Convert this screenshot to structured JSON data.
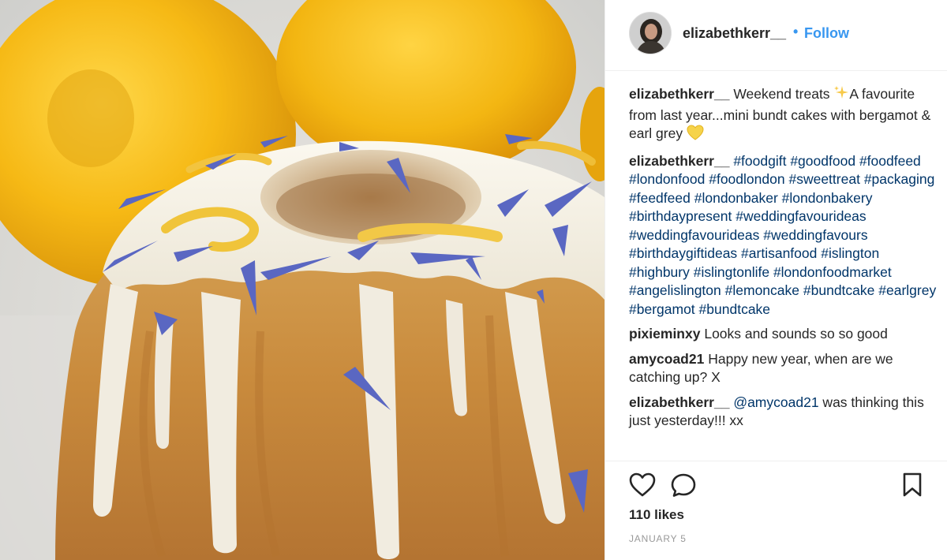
{
  "post": {
    "username": "elizabethkerr__",
    "follow_dot": "•",
    "follow_label": "Follow",
    "likes": "110 likes",
    "date": "JANUARY 5"
  },
  "caption": {
    "username": "elizabethkerr__",
    "text_part1": "Weekend treats ",
    "text_part2": "A favourite from last year...mini bundt cakes with bergamot & earl grey "
  },
  "hashtag_comment": {
    "username": "elizabethkerr__",
    "hashtags": [
      "#foodgift",
      "#goodfood",
      "#foodfeed",
      "#londonfood",
      "#foodlondon",
      "#sweettreat",
      "#packaging",
      "#feedfeed",
      "#londonbaker",
      "#londonbakery",
      "#birthdaypresent",
      "#weddingfavourideas",
      "#weddingfavourideas",
      "#weddingfavours",
      "#birthdaygiftideas",
      "#artisanfood",
      "#islington",
      "#highbury",
      "#islingtonlife",
      "#londonfoodmarket",
      "#angelislington",
      "#lemoncake",
      "#bundtcake",
      "#earlgrey",
      "#bergamot",
      "#bundtcake"
    ]
  },
  "comments": [
    {
      "username": "pixieminxy",
      "text": "Looks and sounds so so good"
    },
    {
      "username": "amycoad21",
      "text": "Happy new year, when are we catching up? X"
    }
  ],
  "reply": {
    "username": "elizabethkerr__",
    "mention": "@amycoad21",
    "text": " was thinking this just yesterday!!! xx"
  },
  "icons": {
    "like": "heart-outline-icon",
    "comment": "speech-bubble-icon",
    "save": "bookmark-icon",
    "sparkle": "sparkles-emoji",
    "heart": "yellow-heart-emoji"
  },
  "colors": {
    "link_blue": "#3897f0",
    "hashtag_blue": "#003569",
    "text": "#262626",
    "muted": "#999999"
  }
}
